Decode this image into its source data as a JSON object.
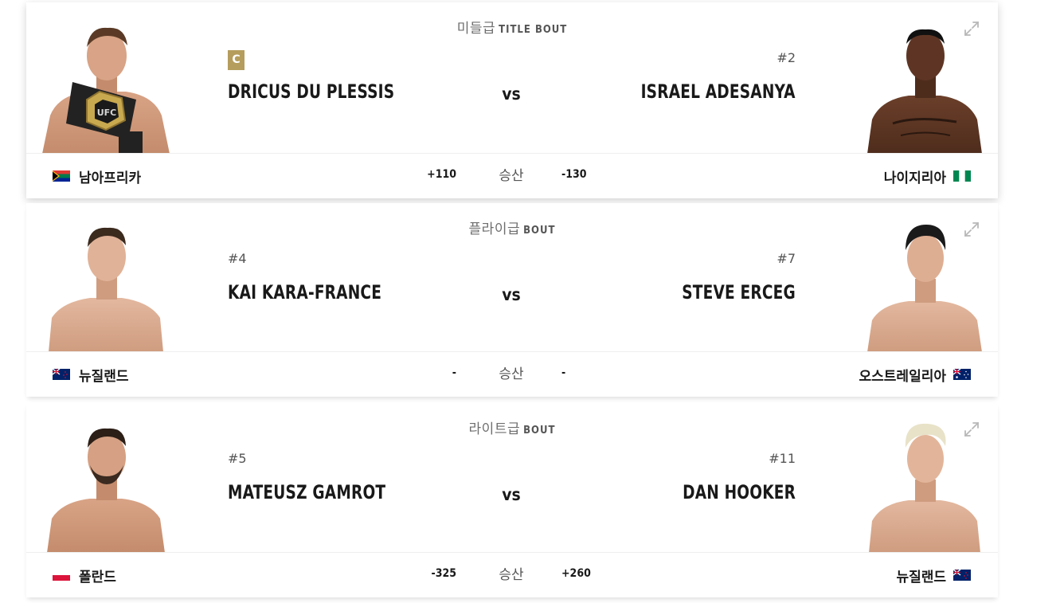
{
  "fights": [
    {
      "weight_class": "미들급",
      "bout_label": "TITLE BOUT",
      "champion_badge": "C",
      "vs": "vs",
      "result_label": "승산",
      "red": {
        "rank": "",
        "name": "DRICUS DU PLESSIS",
        "country": "남아프리카",
        "odds": "+110",
        "flag": "south-africa-flag",
        "photo": "fighter-photo-holding-ufc-belt"
      },
      "blue": {
        "rank": "#2",
        "name": "ISRAEL ADESANYA",
        "country": "나이지리아",
        "odds": "-130",
        "flag": "nigeria-flag",
        "photo": "fighter-photo"
      }
    },
    {
      "weight_class": "플라이급",
      "bout_label": "BOUT",
      "vs": "vs",
      "result_label": "승산",
      "red": {
        "rank": "#4",
        "name": "KAI KARA-FRANCE",
        "country": "뉴질랜드",
        "odds": "-",
        "flag": "new-zealand-flag",
        "photo": "fighter-photo"
      },
      "blue": {
        "rank": "#7",
        "name": "STEVE ERCEG",
        "country": "오스트레일리아",
        "odds": "-",
        "flag": "australia-flag",
        "photo": "fighter-photo"
      }
    },
    {
      "weight_class": "라이트급",
      "bout_label": "BOUT",
      "vs": "vs",
      "result_label": "승산",
      "red": {
        "rank": "#5",
        "name": "MATEUSZ GAMROT",
        "country": "폴란드",
        "odds": "-325",
        "flag": "poland-flag",
        "photo": "fighter-photo"
      },
      "blue": {
        "rank": "#11",
        "name": "DAN HOOKER",
        "country": "뉴질랜드",
        "odds": "+260",
        "flag": "new-zealand-flag",
        "photo": "fighter-photo"
      }
    }
  ],
  "icons": {
    "expand": "expand-icon"
  },
  "colors": {
    "champion_badge": "#b59d5d",
    "text": "#191919",
    "muted": "#6e6e6e"
  }
}
